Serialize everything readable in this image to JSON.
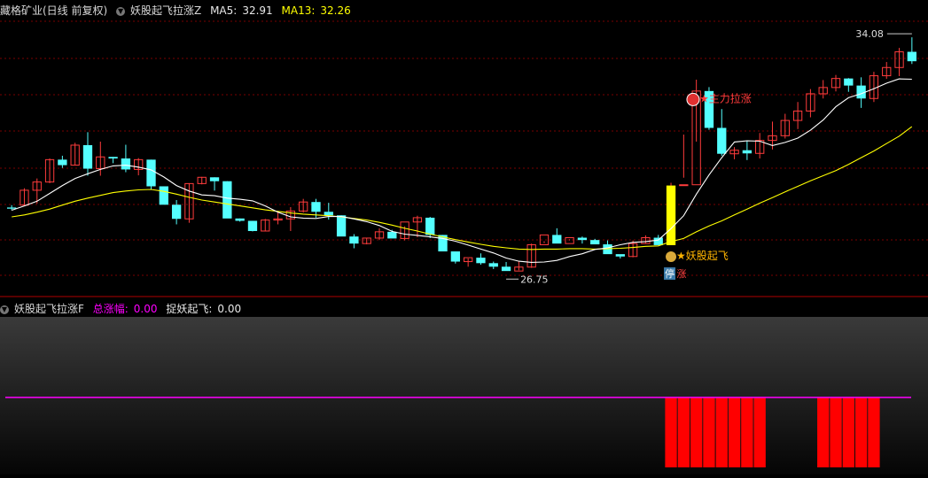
{
  "top_header": {
    "stock": "藏格矿业(日线 前复权)",
    "indicator": "妖股起飞拉涨Z",
    "ma5_label": "MA5:",
    "ma5_value": "32.91",
    "ma13_label": "MA13:",
    "ma13_value": "32.26"
  },
  "bottom_header": {
    "indicator": "妖股起飞拉涨F",
    "total_label": "总涨幅:",
    "total_value": "0.00",
    "catch_label": "捉妖起飞:",
    "catch_value": "0.00"
  },
  "colors": {
    "up": "#ff3c3c",
    "down": "#54ffff",
    "ma5": "#ffffff",
    "ma13": "#ffff00",
    "grid": "#7a0000",
    "signal_bar": "#ff0000",
    "signal_line": "#ff00ff",
    "launch_bar": "#ffff00"
  },
  "chart_data": [
    {
      "type": "candlestick",
      "title": "藏格矿业(日线 前复权)",
      "annotations": {
        "high": "34.08",
        "low": "26.75",
        "signal_launch": "妖股起飞",
        "signal_rally": "主力拉涨",
        "limit_badge_left": "停",
        "limit_badge_right": "涨"
      },
      "ohlc": [
        [
          29.74,
          29.8,
          29.67,
          29.71
        ],
        [
          29.8,
          30.23,
          29.8,
          30.18
        ],
        [
          30.18,
          30.48,
          29.84,
          30.39
        ],
        [
          30.39,
          30.99,
          30.36,
          30.96
        ],
        [
          30.96,
          31.06,
          30.75,
          30.82
        ],
        [
          30.82,
          31.39,
          30.82,
          31.33
        ],
        [
          31.33,
          31.66,
          30.55,
          30.73
        ],
        [
          30.73,
          31.42,
          30.55,
          31.03
        ],
        [
          31.03,
          31.03,
          30.87,
          30.99
        ],
        [
          30.99,
          31.34,
          30.64,
          30.71
        ],
        [
          30.71,
          31.0,
          30.56,
          30.96
        ],
        [
          30.96,
          30.96,
          30.19,
          30.28
        ],
        [
          30.28,
          30.28,
          29.93,
          29.81
        ],
        [
          29.81,
          29.93,
          29.31,
          29.45
        ],
        [
          29.45,
          30.36,
          29.35,
          30.35
        ],
        [
          30.35,
          30.52,
          30.33,
          30.51
        ],
        [
          30.51,
          30.51,
          30.17,
          30.41
        ],
        [
          30.41,
          30.41,
          29.49,
          29.46
        ],
        [
          29.46,
          29.46,
          29.38,
          29.4
        ],
        [
          29.4,
          29.4,
          29.13,
          29.14
        ],
        [
          29.14,
          29.45,
          29.13,
          29.42
        ],
        [
          29.42,
          29.65,
          29.31,
          29.45
        ],
        [
          29.45,
          29.75,
          29.14,
          29.65
        ],
        [
          29.65,
          29.96,
          29.61,
          29.88
        ],
        [
          29.88,
          29.96,
          29.48,
          29.63
        ],
        [
          29.63,
          29.86,
          29.43,
          29.54
        ],
        [
          29.54,
          29.54,
          29.01,
          29.0
        ],
        [
          29.0,
          29.06,
          28.7,
          28.82
        ],
        [
          28.82,
          28.96,
          28.8,
          28.96
        ],
        [
          28.96,
          29.21,
          28.91,
          29.12
        ],
        [
          29.12,
          29.17,
          28.98,
          28.95
        ],
        [
          28.95,
          29.26,
          28.9,
          29.37
        ],
        [
          29.37,
          29.53,
          28.98,
          29.48
        ],
        [
          29.48,
          29.5,
          28.96,
          29.04
        ],
        [
          29.04,
          29.04,
          28.63,
          28.62
        ],
        [
          28.62,
          28.62,
          28.31,
          28.36
        ],
        [
          28.36,
          28.44,
          28.23,
          28.46
        ],
        [
          28.46,
          28.57,
          28.28,
          28.32
        ],
        [
          28.32,
          28.36,
          28.17,
          28.23
        ],
        [
          28.23,
          28.35,
          28.14,
          28.12
        ],
        [
          28.12,
          28.36,
          28.14,
          28.22
        ],
        [
          28.22,
          28.82,
          28.2,
          28.79
        ],
        [
          28.79,
          28.88,
          28.83,
          29.04
        ],
        [
          29.04,
          29.21,
          29.0,
          28.82
        ],
        [
          28.82,
          28.93,
          28.9,
          28.97
        ],
        [
          28.97,
          29.0,
          28.82,
          28.91
        ],
        [
          28.91,
          28.94,
          28.82,
          28.8
        ],
        [
          28.8,
          28.9,
          28.56,
          28.55
        ],
        [
          28.55,
          28.5,
          28.44,
          28.49
        ],
        [
          28.49,
          28.9,
          28.47,
          28.82
        ],
        [
          28.82,
          29.03,
          28.83,
          28.97
        ],
        [
          28.97,
          29.04,
          28.88,
          28.78
        ],
        [
          28.78,
          30.37,
          28.8,
          30.3
        ],
        [
          30.3,
          31.6,
          30.5,
          30.32
        ],
        [
          30.32,
          33.0,
          31.42,
          32.71
        ],
        [
          32.71,
          32.81,
          31.72,
          31.77
        ],
        [
          31.77,
          32.25,
          31.06,
          31.11
        ],
        [
          31.11,
          31.28,
          30.97,
          31.2
        ],
        [
          31.2,
          31.44,
          30.95,
          31.12
        ],
        [
          31.12,
          31.64,
          30.99,
          31.45
        ],
        [
          31.45,
          31.93,
          31.22,
          31.57
        ],
        [
          31.57,
          32.13,
          31.5,
          31.96
        ],
        [
          31.96,
          32.43,
          31.74,
          32.2
        ],
        [
          32.2,
          32.76,
          32.04,
          32.64
        ],
        [
          32.64,
          32.99,
          32.52,
          32.8
        ],
        [
          32.8,
          33.12,
          32.7,
          33.03
        ],
        [
          33.03,
          33.04,
          32.69,
          32.85
        ],
        [
          32.85,
          33.06,
          32.28,
          32.52
        ],
        [
          32.52,
          33.2,
          32.43,
          33.1
        ],
        [
          33.1,
          33.45,
          33.02,
          33.31
        ],
        [
          33.31,
          33.81,
          33.09,
          33.71
        ],
        [
          33.71,
          34.08,
          33.4,
          33.47
        ]
      ],
      "ma5": [
        29.67,
        29.78,
        29.9,
        30.1,
        30.3,
        30.48,
        30.6,
        30.71,
        30.8,
        30.82,
        30.77,
        30.7,
        30.52,
        30.3,
        30.16,
        30.06,
        30.04,
        29.98,
        29.95,
        29.91,
        29.78,
        29.62,
        29.5,
        29.47,
        29.46,
        29.51,
        29.51,
        29.45,
        29.38,
        29.28,
        29.13,
        29.06,
        29.03,
        28.99,
        28.95,
        28.88,
        28.78,
        28.68,
        28.58,
        28.45,
        28.37,
        28.34,
        28.35,
        28.39,
        28.49,
        28.56,
        28.67,
        28.71,
        28.79,
        28.85,
        28.87,
        28.91,
        29.2,
        29.53,
        30.08,
        30.57,
        31.01,
        31.41,
        31.44,
        31.43,
        31.32,
        31.4,
        31.51,
        31.71,
        31.97,
        32.31,
        32.54,
        32.64,
        32.77,
        32.91,
        33.02,
        33.01
      ],
      "ma13": [
        29.5,
        29.55,
        29.62,
        29.7,
        29.8,
        29.9,
        29.98,
        30.05,
        30.12,
        30.16,
        30.19,
        30.2,
        30.15,
        30.08,
        30.0,
        29.93,
        29.88,
        29.83,
        29.78,
        29.73,
        29.68,
        29.64,
        29.6,
        29.57,
        29.55,
        29.53,
        29.5,
        29.46,
        29.42,
        29.36,
        29.29,
        29.21,
        29.14,
        29.06,
        28.99,
        28.92,
        28.86,
        28.8,
        28.75,
        28.71,
        28.68,
        28.67,
        28.68,
        28.68,
        28.69,
        28.69,
        28.68,
        28.69,
        28.7,
        28.72,
        28.75,
        28.76,
        28.87,
        28.95,
        29.12,
        29.27,
        29.4,
        29.55,
        29.7,
        29.85,
        29.99,
        30.14,
        30.28,
        30.42,
        30.55,
        30.68,
        30.84,
        31.01,
        31.18,
        31.37,
        31.56,
        31.8
      ],
      "signal_launch_index": 52,
      "signal_rally_index": 55
    },
    {
      "type": "bar",
      "title": "妖股起飞拉涨F",
      "series": [
        {
          "name": "捉妖起飞",
          "values": [
            0,
            0,
            0,
            0,
            0,
            0,
            0,
            0,
            0,
            0,
            0,
            0,
            0,
            0,
            0,
            0,
            0,
            0,
            0,
            0,
            0,
            0,
            0,
            0,
            0,
            0,
            0,
            0,
            0,
            0,
            0,
            0,
            0,
            0,
            0,
            0,
            0,
            0,
            0,
            0,
            0,
            0,
            0,
            0,
            0,
            0,
            0,
            0,
            0,
            0,
            0,
            0,
            1,
            1,
            1,
            1,
            1,
            1,
            1,
            1,
            0,
            0,
            0,
            0,
            1,
            1,
            1,
            1,
            1,
            0,
            0,
            0
          ]
        }
      ],
      "baseline": 0
    }
  ]
}
